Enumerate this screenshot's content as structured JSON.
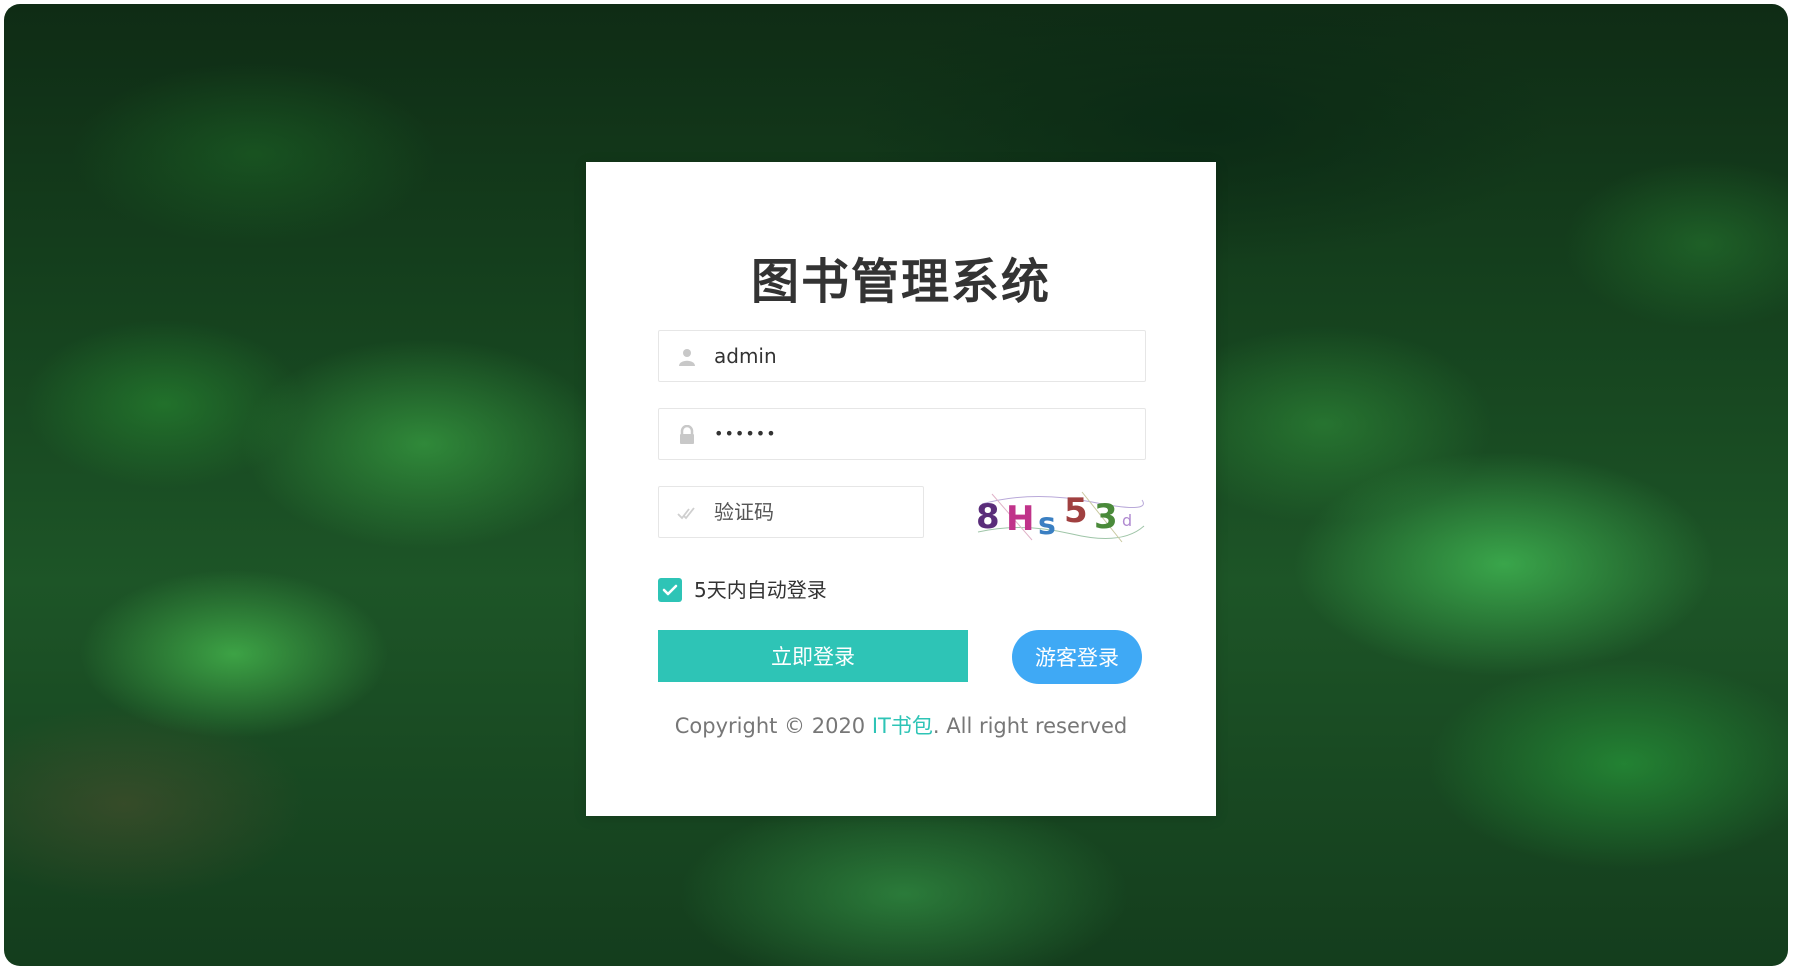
{
  "app": {
    "title": "图书管理系统"
  },
  "login_form": {
    "username": {
      "value": "admin",
      "icon": "user-icon"
    },
    "password": {
      "value": "••••••",
      "icon": "lock-icon"
    },
    "captcha_input": {
      "placeholder": "验证码",
      "icon": "check-icon"
    },
    "captcha_image": {
      "text": "8Hs53"
    },
    "remember": {
      "label": "5天内自动登录",
      "checked": true
    },
    "login_button": "立即登录",
    "guest_button": "游客登录"
  },
  "footer": {
    "prefix": "Copyright © 2020 ",
    "link": "IT书包",
    "suffix": ". All right reserved"
  },
  "colors": {
    "primary": "#2ec4b6",
    "guest": "#3fa9f5",
    "title": "#333333",
    "copyright": "#777777"
  }
}
